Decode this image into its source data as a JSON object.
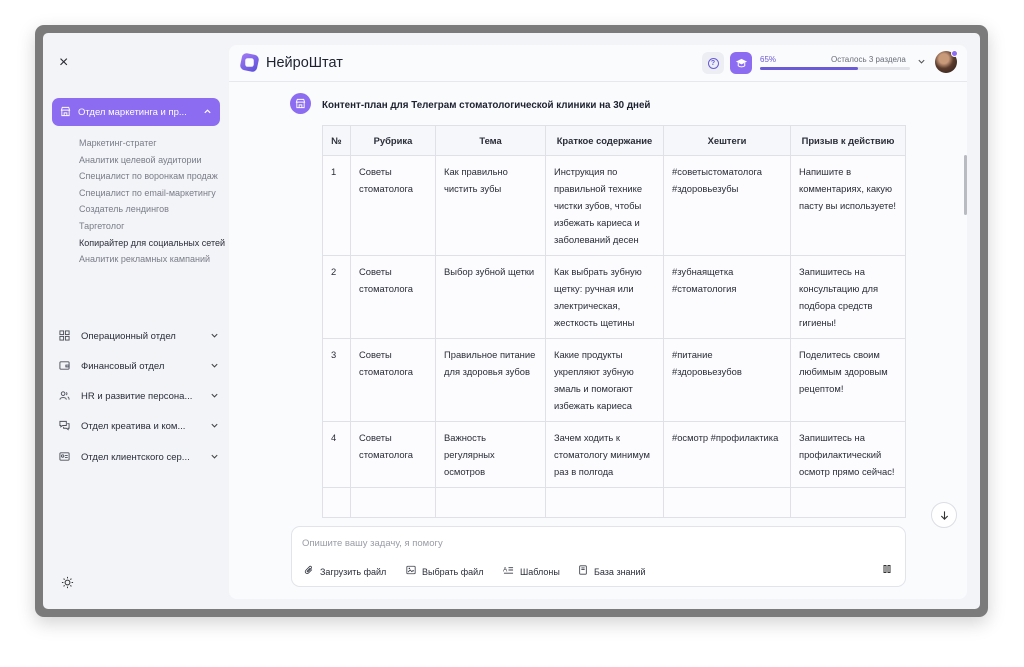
{
  "sidebar": {
    "close_icon": "×",
    "active_department": {
      "label": "Отдел маркетинга и пр...",
      "icon": "store-icon"
    },
    "sub_items": [
      {
        "label": "Маркетинг-стратег",
        "active": false
      },
      {
        "label": "Аналитик целевой аудитории",
        "active": false
      },
      {
        "label": "Специалист по воронкам продаж",
        "active": false
      },
      {
        "label": "Специалист по email-маркетингу",
        "active": false
      },
      {
        "label": "Создатель лендингов",
        "active": false
      },
      {
        "label": "Таргетолог",
        "active": false
      },
      {
        "label": "Копирайтер для социальных сетей",
        "active": true
      },
      {
        "label": "Аналитик рекламных кампаний",
        "active": false
      }
    ],
    "departments": [
      {
        "label": "Операционный отдел",
        "icon": "grid-icon"
      },
      {
        "label": "Финансовый отдел",
        "icon": "wallet-icon"
      },
      {
        "label": "HR и развитие персона...",
        "icon": "users-icon"
      },
      {
        "label": "Отдел креатива и ком...",
        "icon": "chat-icon"
      },
      {
        "label": "Отдел клиентского сер...",
        "icon": "id-card-icon"
      }
    ],
    "theme_icon": "sun-icon"
  },
  "header": {
    "brand": "НейроШтат",
    "progress_label": "65%",
    "progress_value": 0.65,
    "remaining_label": "Осталось 3 раздела"
  },
  "message": {
    "title": "Контент-план для Телеграм стоматологической клиники на 30 дней",
    "table": {
      "headers": [
        "№",
        "Рубрика",
        "Тема",
        "Краткое содержание",
        "Хештеги",
        "Призыв к действию"
      ],
      "rows": [
        [
          "1",
          "Советы стоматолога",
          "Как правильно чистить зубы",
          "Инструкция по правильной технике чистки зубов, чтобы избежать кариеса и заболеваний десен",
          "#советыстоматолога #здоровьезубы",
          "Напишите в комментариях, какую пасту вы используете!"
        ],
        [
          "2",
          "Советы стоматолога",
          "Выбор зубной щетки",
          "Как выбрать зубную щетку: ручная или электрическая, жесткость щетины",
          "#зубнаящетка #стоматология",
          "Запишитесь на консультацию для подбора средств гигиены!"
        ],
        [
          "3",
          "Советы стоматолога",
          "Правильное питание для здоровья зубов",
          "Какие продукты укрепляют зубную эмаль и помогают избежать кариеса",
          "#питание #здоровьезубов",
          "Поделитесь своим любимым здоровым рецептом!"
        ],
        [
          "4",
          "Советы стоматолога",
          "Важность регулярных осмотров",
          "Зачем ходить к стоматологу минимум раз в полгода",
          "#осмотр #профилактика",
          "Запишитесь на профилактический осмотр прямо сейчас!"
        ],
        [
          "",
          "",
          "",
          "",
          "",
          ""
        ]
      ]
    }
  },
  "composer": {
    "placeholder": "Опишите вашу задачу, я помогу",
    "tools": [
      {
        "label": "Загрузить файл",
        "icon": "paperclip-icon"
      },
      {
        "label": "Выбрать файл",
        "icon": "image-file-icon"
      },
      {
        "label": "Шаблоны",
        "icon": "template-icon"
      },
      {
        "label": "База знаний",
        "icon": "book-icon"
      }
    ]
  }
}
